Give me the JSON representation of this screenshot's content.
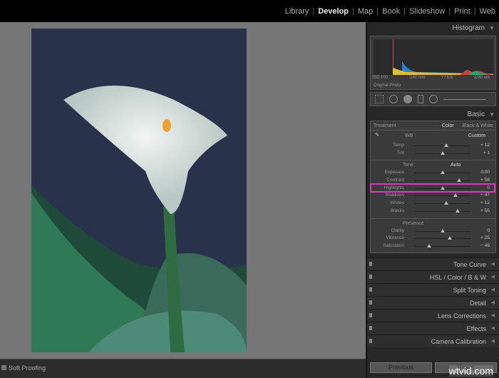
{
  "modules": [
    "Library",
    "Develop",
    "Map",
    "Book",
    "Slideshow",
    "Print",
    "Web"
  ],
  "active_module": "Develop",
  "bottom": {
    "soft_proofing": "Soft Proofing"
  },
  "histogram": {
    "title": "Histogram",
    "iso": "ISO 100",
    "focal": "140 mm",
    "aperture": "f / 5.6",
    "shutter": "1/20 sec",
    "original_photo": "Original Photo"
  },
  "basic": {
    "title": "Basic",
    "treatment_label": "Treatment :",
    "color": "Color",
    "bw": "Black & White",
    "wb_label": "WB :",
    "wb_value": "Custom",
    "tone_label": "Tone",
    "auto": "Auto",
    "presence_label": "Presence",
    "wb_sliders": [
      {
        "label": "Temp",
        "value": "+ 12",
        "pos": 0.56
      },
      {
        "label": "Tint",
        "value": "+ 1",
        "pos": 0.505
      }
    ],
    "tone_sliders": [
      {
        "label": "Exposure",
        "value": "0.00",
        "pos": 0.5
      },
      {
        "label": "Contrast",
        "value": "+ 58",
        "pos": 0.79
      },
      {
        "label": "Highlights",
        "value": "0",
        "pos": 0.5
      },
      {
        "label": "Shadows",
        "value": "+ 47",
        "pos": 0.735
      },
      {
        "label": "Whites",
        "value": "+ 12",
        "pos": 0.56
      },
      {
        "label": "Blacks",
        "value": "+ 55",
        "pos": 0.775
      }
    ],
    "presence_sliders": [
      {
        "label": "Clarity",
        "value": "0",
        "pos": 0.5
      },
      {
        "label": "Vibrance",
        "value": "+ 25",
        "pos": 0.625
      },
      {
        "label": "Saturation",
        "value": "− 49",
        "pos": 0.255
      }
    ]
  },
  "panels": [
    "Tone Curve",
    "HSL / Color / B & W",
    "Split Toning",
    "Detail",
    "Lens Corrections",
    "Effects",
    "Camera Calibration"
  ],
  "buttons": {
    "previous": "Previous",
    "reset": "Reset"
  },
  "watermark": "wtvid.com",
  "colors": {
    "highlight": "#e034c8"
  }
}
